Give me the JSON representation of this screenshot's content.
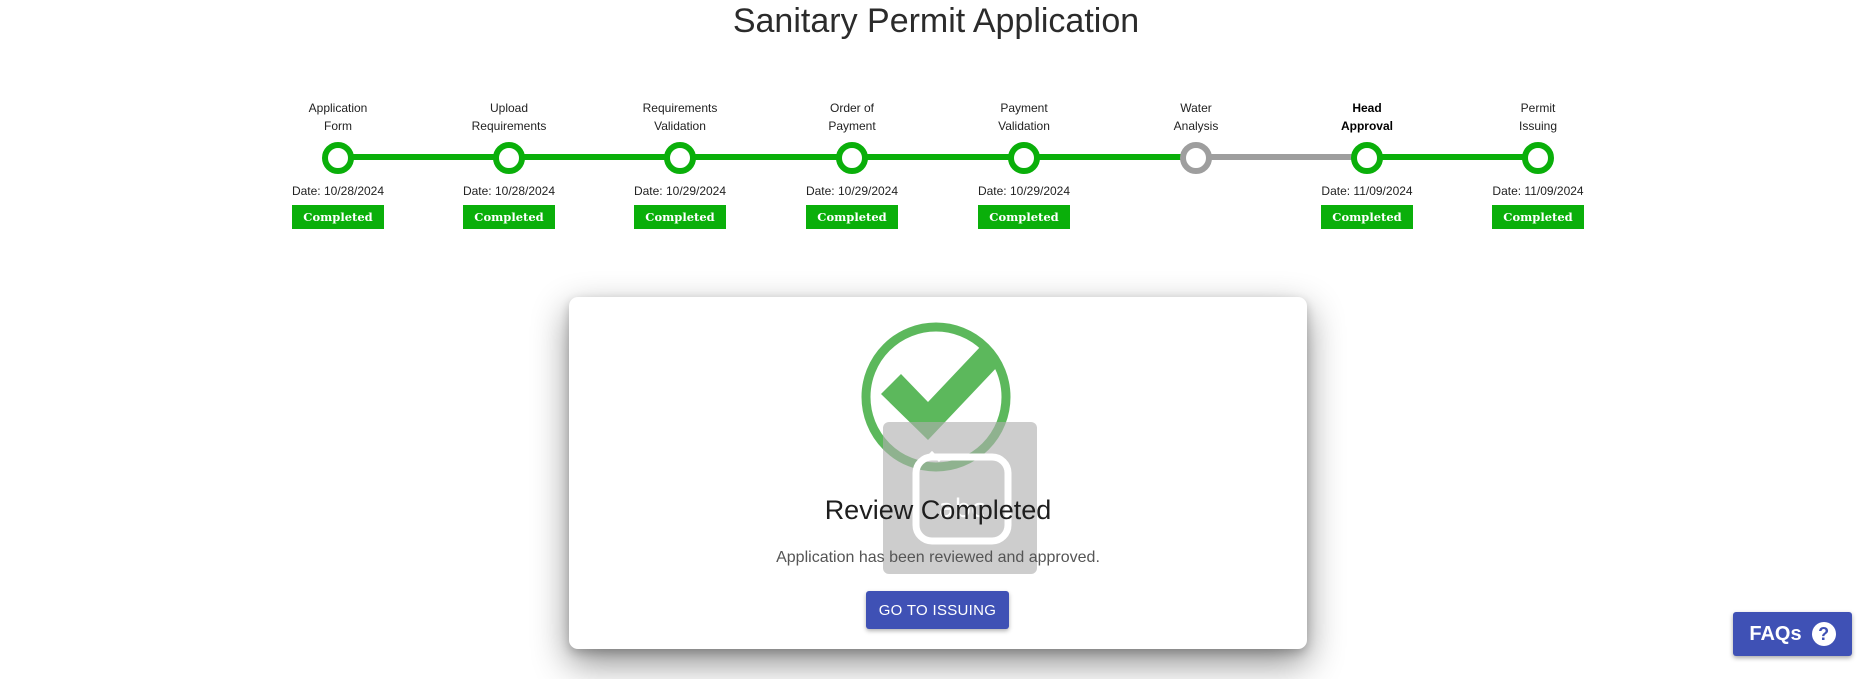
{
  "page_title": "Sanitary Permit Application",
  "colors": {
    "completed": "#0aaf0a",
    "pending": "#9e9e9e",
    "primary": "#3f51b5"
  },
  "steps": [
    {
      "label_line1": "Application",
      "label_line2": "Form",
      "date": "Date: 10/28/2024",
      "status": "Completed",
      "active": false
    },
    {
      "label_line1": "Upload",
      "label_line2": "Requirements",
      "date": "Date: 10/28/2024",
      "status": "Completed",
      "active": false
    },
    {
      "label_line1": "Requirements",
      "label_line2": "Validation",
      "date": "Date: 10/29/2024",
      "status": "Completed",
      "active": false
    },
    {
      "label_line1": "Order of",
      "label_line2": "Payment",
      "date": "Date: 10/29/2024",
      "status": "Completed",
      "active": false
    },
    {
      "label_line1": "Payment",
      "label_line2": "Validation",
      "date": "Date: 10/29/2024",
      "status": "Completed",
      "active": false
    },
    {
      "label_line1": "Water",
      "label_line2": "Analysis",
      "date": "",
      "status": "",
      "active": false
    },
    {
      "label_line1": "Head",
      "label_line2": "Approval",
      "date": "Date: 11/09/2024",
      "status": "Completed",
      "active": true
    },
    {
      "label_line1": "Permit",
      "label_line2": "Issuing",
      "date": "Date: 11/09/2024",
      "status": "Completed",
      "active": false
    }
  ],
  "card": {
    "icon": "check-circle-icon",
    "overlay_icon": "keyboard-abc-icon",
    "overlay_text": "abc",
    "title": "Review Completed",
    "message": "Application has been reviewed and approved.",
    "button_label": "GO TO ISSUING"
  },
  "faq": {
    "label": "FAQs",
    "icon": "help-circle-icon",
    "icon_glyph": "?"
  }
}
